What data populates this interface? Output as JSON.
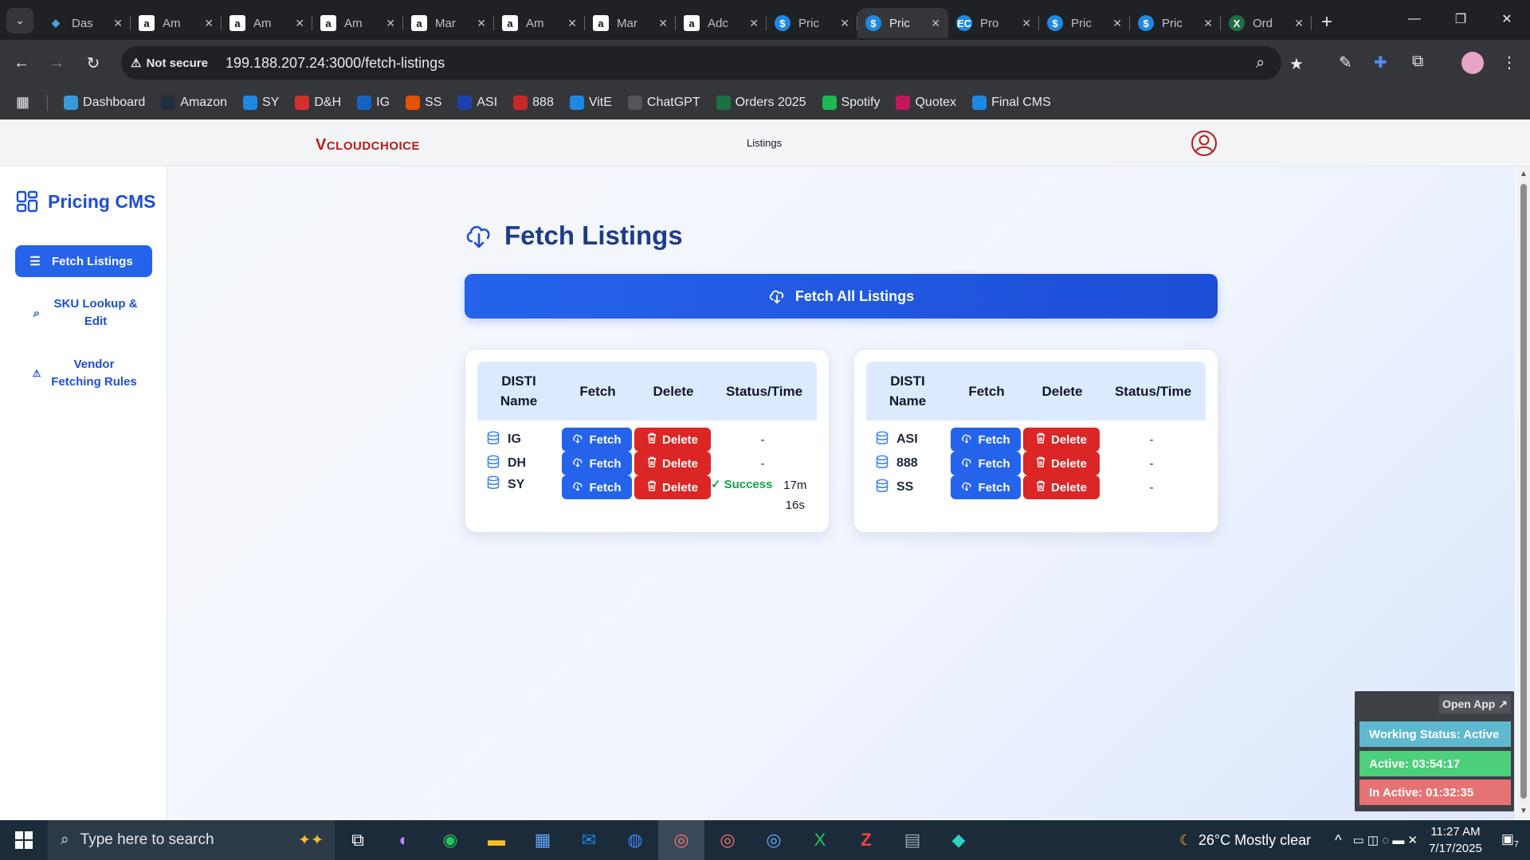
{
  "browser": {
    "tabs": [
      {
        "title": "Das",
        "icon": "diamond-icon",
        "color": "#4aa3df",
        "glyph": "◆"
      },
      {
        "title": "Am",
        "icon": "amazon-icon",
        "color": "#ffffff",
        "glyph": "a"
      },
      {
        "title": "Am",
        "icon": "amazon-icon",
        "color": "#ffffff",
        "glyph": "a"
      },
      {
        "title": "Am",
        "icon": "amazon-icon",
        "color": "#ffffff",
        "glyph": "a"
      },
      {
        "title": "Mar",
        "icon": "amazon-icon",
        "color": "#ffffff",
        "glyph": "a"
      },
      {
        "title": "Am",
        "icon": "amazon-icon",
        "color": "#ffffff",
        "glyph": "a"
      },
      {
        "title": "Mar",
        "icon": "amazon-icon",
        "color": "#ffffff",
        "glyph": "a"
      },
      {
        "title": "Adc",
        "icon": "amazon-icon",
        "color": "#ffffff",
        "glyph": "a"
      },
      {
        "title": "Pric",
        "icon": "dollar-icon",
        "color": "#1e88e5",
        "glyph": "$"
      },
      {
        "title": "Pric",
        "icon": "dollar-icon",
        "color": "#1e88e5",
        "glyph": "$",
        "active": true
      },
      {
        "title": "Pro",
        "icon": "ec-icon",
        "color": "#1e88e5",
        "glyph": "EC"
      },
      {
        "title": "Pric",
        "icon": "dollar-icon",
        "color": "#1e88e5",
        "glyph": "$"
      },
      {
        "title": "Pric",
        "icon": "dollar-icon",
        "color": "#1e88e5",
        "glyph": "$"
      },
      {
        "title": "Ord",
        "icon": "excel-icon",
        "color": "#1d7044",
        "glyph": "X"
      }
    ],
    "not_secure": "Not secure",
    "url": "199.188.207.24:3000/fetch-listings",
    "bookmarks": [
      {
        "label": "Dashboard",
        "color": "#3a9ad9"
      },
      {
        "label": "Amazon",
        "color": "#232f3e"
      },
      {
        "label": "SY",
        "color": "#1e88e5"
      },
      {
        "label": "D&H",
        "color": "#d32f2f"
      },
      {
        "label": "IG",
        "color": "#1565c0"
      },
      {
        "label": "SS",
        "color": "#e65100"
      },
      {
        "label": "ASI",
        "color": "#1e40af"
      },
      {
        "label": "888",
        "color": "#c62828"
      },
      {
        "label": "VitE",
        "color": "#1e88e5"
      },
      {
        "label": "ChatGPT",
        "color": "#555555"
      },
      {
        "label": "Orders 2025",
        "color": "#1d7044"
      },
      {
        "label": "Spotify",
        "color": "#1db954"
      },
      {
        "label": "Quotex",
        "color": "#c2185b"
      },
      {
        "label": "Final CMS",
        "color": "#1e88e5"
      }
    ]
  },
  "header": {
    "logo": "CLOUDCHOICE",
    "logo_v": "V",
    "nav_listings": "Listings"
  },
  "sidebar": {
    "brand": "Pricing CMS",
    "items": [
      {
        "label": "Fetch Listings",
        "icon": "list-icon"
      },
      {
        "label": "SKU Lookup & Edit",
        "icon": "search-icon"
      },
      {
        "label": "Vendor Fetching Rules",
        "icon": "warning-icon"
      }
    ]
  },
  "main": {
    "title": "Fetch Listings",
    "fetch_all_label": "Fetch All Listings",
    "columns": [
      "DISTI Name",
      "Fetch",
      "Delete",
      "Status/Time"
    ],
    "fetch_label": "Fetch",
    "delete_label": "Delete",
    "left_table": [
      {
        "name": "IG",
        "status": "-"
      },
      {
        "name": "DH",
        "status": "-"
      },
      {
        "name": "SY",
        "status": "Success",
        "time": "17m 16s"
      }
    ],
    "right_table": [
      {
        "name": "ASI",
        "status": "-"
      },
      {
        "name": "888",
        "status": "-"
      },
      {
        "name": "SS",
        "status": "-"
      }
    ]
  },
  "widget": {
    "open_app": "Open App ↗",
    "working_status": "Working Status: Active",
    "active": "Active: 03:54:17",
    "inactive": "In Active: 01:32:35",
    "colors": {
      "working": "#5fb8cf",
      "active": "#4ccf7a",
      "inactive": "#e57373"
    }
  },
  "taskbar": {
    "search_placeholder": "Type here to search",
    "weather": "26°C  Mostly clear",
    "time": "11:27 AM",
    "date": "7/17/2025",
    "notification_count": "7"
  }
}
